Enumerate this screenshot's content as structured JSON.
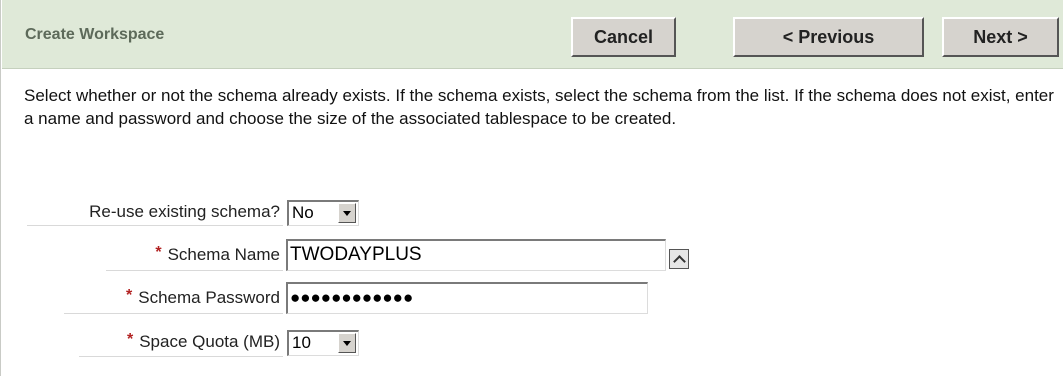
{
  "region": {
    "title": "Create Workspace"
  },
  "buttons": {
    "cancel": "Cancel",
    "previous": "< Previous",
    "next": "Next >"
  },
  "instructions": "Select whether or not the schema already exists. If the schema exists, select the schema from the list. If the schema does not exist, enter a name and password and choose the size of the associated tablespace to be created.",
  "form": {
    "reuse_schema": {
      "label": "Re-use existing schema?",
      "value": "No",
      "required": false
    },
    "schema_name": {
      "label": "Schema Name",
      "value": "TWODAYPLUS",
      "required": true
    },
    "schema_password": {
      "label": "Schema Password",
      "value": "●●●●●●●●●●●●",
      "required": true
    },
    "space_quota": {
      "label": "Space Quota (MB)",
      "value": "10",
      "required": true
    }
  },
  "required_marker": "*",
  "icons": {
    "select_arrow": "chevron-down-icon",
    "list_of_values": "popup-lov-icon"
  },
  "colors": {
    "header_bg": "#dfe9d8",
    "title_text": "#5d6a5a",
    "button_face": "#d6d3ce",
    "required_marker": "#b22222"
  }
}
